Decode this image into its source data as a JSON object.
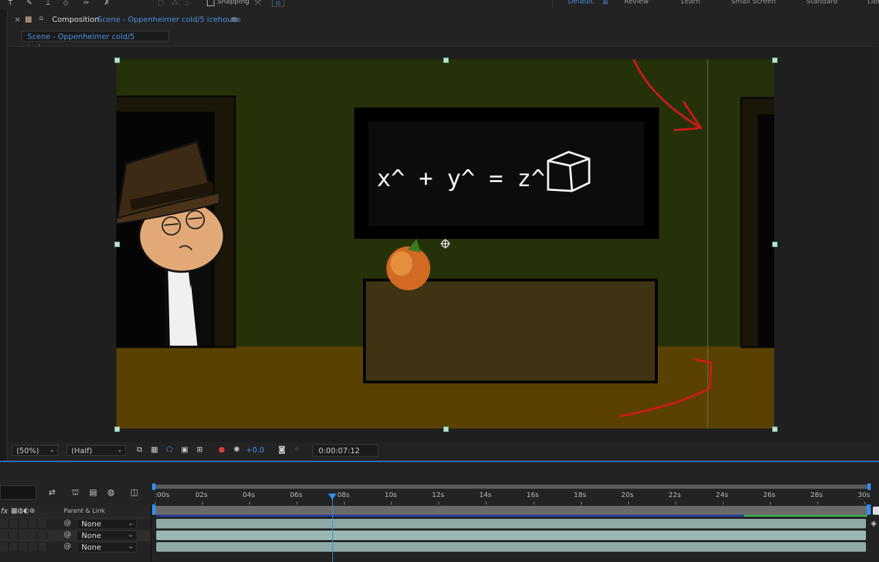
{
  "topbar": {
    "snapping_label": "Snapping",
    "workspaces": [
      "Default",
      "Review",
      "Learn",
      "Small Screen",
      "Standard",
      "Libr"
    ],
    "workspace_menu_icon": "≡"
  },
  "panel": {
    "close_icon": "×",
    "lock_icon": "🔓",
    "title": "Composition",
    "comp_name": "Scene - Oppenheimer cold/5 icehouce",
    "menu_icon": "≡",
    "breadcrumb": "Scene - Oppenheimer cold/5 icehouce"
  },
  "canvas": {
    "board_equation": "x^ + y^ = z^",
    "colors": {
      "wall": "#253209",
      "floor": "#5a4102",
      "board": "#0c0c0c",
      "desk": "#3e3312",
      "annotation": "#d21818"
    }
  },
  "viewer_bar": {
    "zoom": "(50%)",
    "resolution": "(Half)",
    "exposure": "+0.0",
    "timecode": "0:00:07:12"
  },
  "timeline": {
    "ruler_labels": [
      ":00s",
      "02s",
      "04s",
      "06s",
      "08s",
      "10s",
      "12s",
      "14s",
      "16s",
      "18s",
      "20s",
      "22s",
      "24s",
      "26s",
      "28s",
      "30s"
    ],
    "fx_label": "fx",
    "parent_header": "Parent & Link",
    "layers": [
      {
        "parent": "None"
      },
      {
        "parent": "None"
      },
      {
        "parent": "None"
      }
    ],
    "current_time_seconds": 7.5,
    "duration_seconds": 30
  }
}
